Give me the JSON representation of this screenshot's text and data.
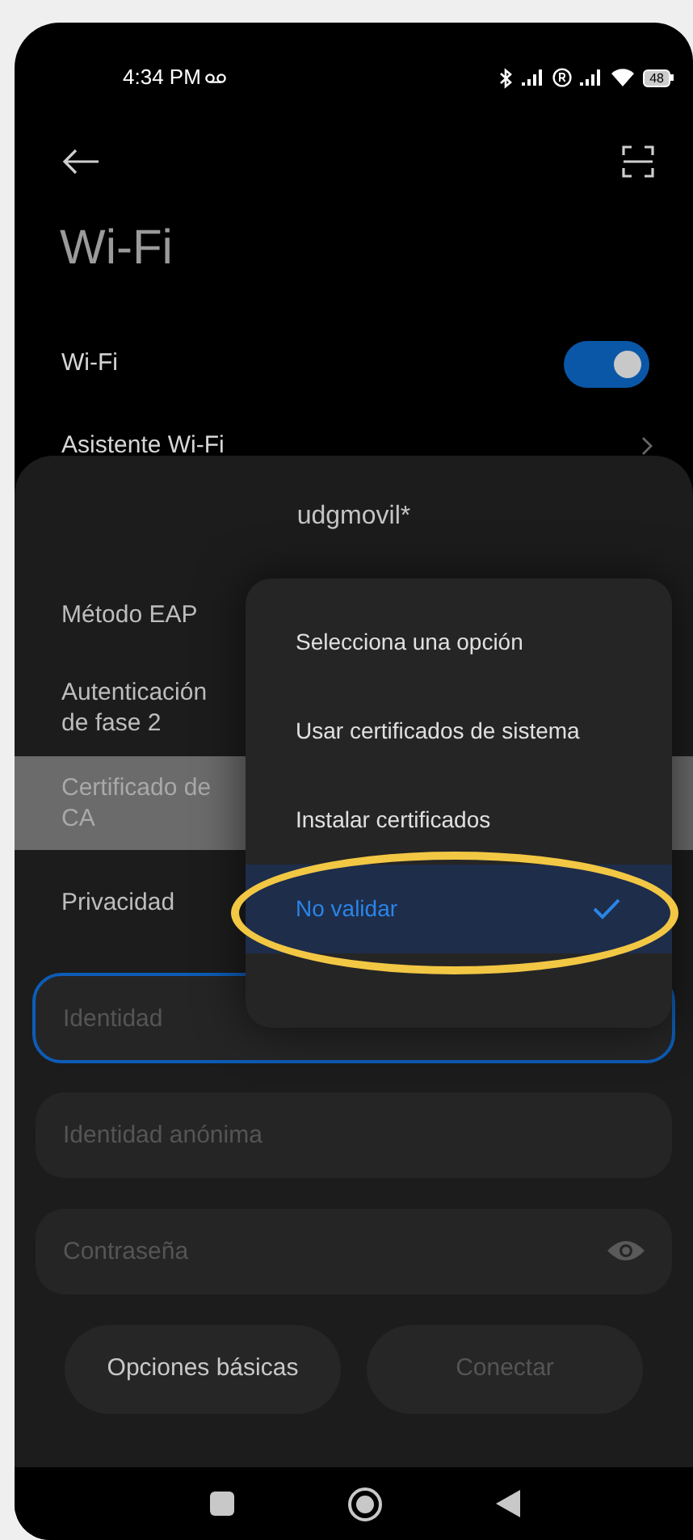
{
  "status_bar": {
    "time": "4:34 PM",
    "battery": "48"
  },
  "header": {
    "title": "Wi-Fi"
  },
  "settings": [
    {
      "kind": "toggle",
      "label": "Wi-Fi",
      "on": true
    },
    {
      "kind": "link",
      "label": "Asistente Wi-Fi"
    }
  ],
  "sheet": {
    "title": "udgmovil*",
    "rows": [
      {
        "label": "Método EAP",
        "selected": false
      },
      {
        "label": "Autenticación de fase 2",
        "selected": false
      },
      {
        "label": "Certificado de CA",
        "selected": true
      },
      {
        "label": "Privacidad",
        "selected": false
      }
    ],
    "fields": [
      {
        "placeholder": "Identidad",
        "focused": true,
        "kind": "text"
      },
      {
        "placeholder": "Identidad anónima",
        "focused": false,
        "kind": "text"
      },
      {
        "placeholder": "Contraseña",
        "focused": false,
        "kind": "password"
      }
    ],
    "buttons": [
      {
        "label": "Opciones básicas",
        "disabled": false
      },
      {
        "label": "Conectar",
        "disabled": true
      }
    ]
  },
  "dropdown": {
    "options": [
      {
        "label": "Selecciona una opción",
        "selected": false
      },
      {
        "label": "Usar certificados de sistema",
        "selected": false
      },
      {
        "label": "Instalar certificados",
        "selected": false
      },
      {
        "label": "No validar",
        "selected": true
      }
    ]
  }
}
